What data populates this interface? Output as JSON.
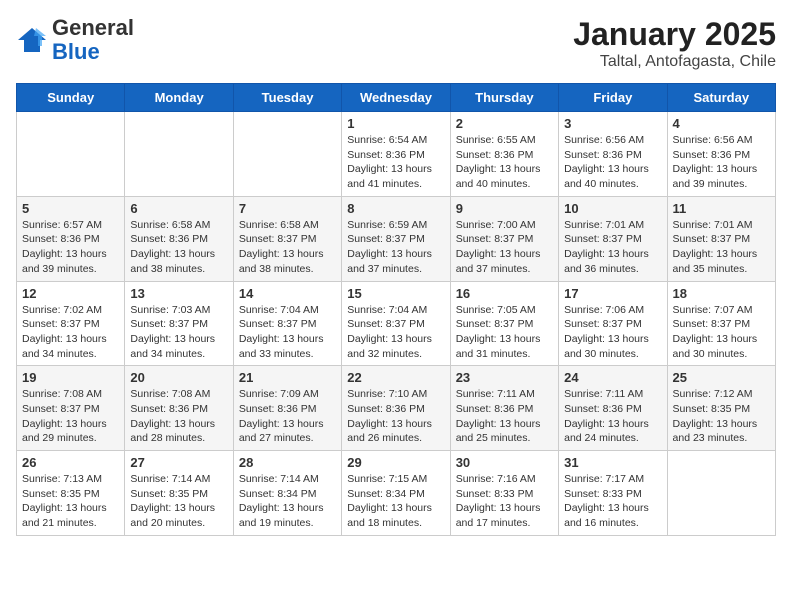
{
  "header": {
    "logo_general": "General",
    "logo_blue": "Blue",
    "title": "January 2025",
    "subtitle": "Taltal, Antofagasta, Chile"
  },
  "weekdays": [
    "Sunday",
    "Monday",
    "Tuesday",
    "Wednesday",
    "Thursday",
    "Friday",
    "Saturday"
  ],
  "weeks": [
    [
      {
        "day": "",
        "info": ""
      },
      {
        "day": "",
        "info": ""
      },
      {
        "day": "",
        "info": ""
      },
      {
        "day": "1",
        "info": "Sunrise: 6:54 AM\nSunset: 8:36 PM\nDaylight: 13 hours\nand 41 minutes."
      },
      {
        "day": "2",
        "info": "Sunrise: 6:55 AM\nSunset: 8:36 PM\nDaylight: 13 hours\nand 40 minutes."
      },
      {
        "day": "3",
        "info": "Sunrise: 6:56 AM\nSunset: 8:36 PM\nDaylight: 13 hours\nand 40 minutes."
      },
      {
        "day": "4",
        "info": "Sunrise: 6:56 AM\nSunset: 8:36 PM\nDaylight: 13 hours\nand 39 minutes."
      }
    ],
    [
      {
        "day": "5",
        "info": "Sunrise: 6:57 AM\nSunset: 8:36 PM\nDaylight: 13 hours\nand 39 minutes."
      },
      {
        "day": "6",
        "info": "Sunrise: 6:58 AM\nSunset: 8:36 PM\nDaylight: 13 hours\nand 38 minutes."
      },
      {
        "day": "7",
        "info": "Sunrise: 6:58 AM\nSunset: 8:37 PM\nDaylight: 13 hours\nand 38 minutes."
      },
      {
        "day": "8",
        "info": "Sunrise: 6:59 AM\nSunset: 8:37 PM\nDaylight: 13 hours\nand 37 minutes."
      },
      {
        "day": "9",
        "info": "Sunrise: 7:00 AM\nSunset: 8:37 PM\nDaylight: 13 hours\nand 37 minutes."
      },
      {
        "day": "10",
        "info": "Sunrise: 7:01 AM\nSunset: 8:37 PM\nDaylight: 13 hours\nand 36 minutes."
      },
      {
        "day": "11",
        "info": "Sunrise: 7:01 AM\nSunset: 8:37 PM\nDaylight: 13 hours\nand 35 minutes."
      }
    ],
    [
      {
        "day": "12",
        "info": "Sunrise: 7:02 AM\nSunset: 8:37 PM\nDaylight: 13 hours\nand 34 minutes."
      },
      {
        "day": "13",
        "info": "Sunrise: 7:03 AM\nSunset: 8:37 PM\nDaylight: 13 hours\nand 34 minutes."
      },
      {
        "day": "14",
        "info": "Sunrise: 7:04 AM\nSunset: 8:37 PM\nDaylight: 13 hours\nand 33 minutes."
      },
      {
        "day": "15",
        "info": "Sunrise: 7:04 AM\nSunset: 8:37 PM\nDaylight: 13 hours\nand 32 minutes."
      },
      {
        "day": "16",
        "info": "Sunrise: 7:05 AM\nSunset: 8:37 PM\nDaylight: 13 hours\nand 31 minutes."
      },
      {
        "day": "17",
        "info": "Sunrise: 7:06 AM\nSunset: 8:37 PM\nDaylight: 13 hours\nand 30 minutes."
      },
      {
        "day": "18",
        "info": "Sunrise: 7:07 AM\nSunset: 8:37 PM\nDaylight: 13 hours\nand 30 minutes."
      }
    ],
    [
      {
        "day": "19",
        "info": "Sunrise: 7:08 AM\nSunset: 8:37 PM\nDaylight: 13 hours\nand 29 minutes."
      },
      {
        "day": "20",
        "info": "Sunrise: 7:08 AM\nSunset: 8:36 PM\nDaylight: 13 hours\nand 28 minutes."
      },
      {
        "day": "21",
        "info": "Sunrise: 7:09 AM\nSunset: 8:36 PM\nDaylight: 13 hours\nand 27 minutes."
      },
      {
        "day": "22",
        "info": "Sunrise: 7:10 AM\nSunset: 8:36 PM\nDaylight: 13 hours\nand 26 minutes."
      },
      {
        "day": "23",
        "info": "Sunrise: 7:11 AM\nSunset: 8:36 PM\nDaylight: 13 hours\nand 25 minutes."
      },
      {
        "day": "24",
        "info": "Sunrise: 7:11 AM\nSunset: 8:36 PM\nDaylight: 13 hours\nand 24 minutes."
      },
      {
        "day": "25",
        "info": "Sunrise: 7:12 AM\nSunset: 8:35 PM\nDaylight: 13 hours\nand 23 minutes."
      }
    ],
    [
      {
        "day": "26",
        "info": "Sunrise: 7:13 AM\nSunset: 8:35 PM\nDaylight: 13 hours\nand 21 minutes."
      },
      {
        "day": "27",
        "info": "Sunrise: 7:14 AM\nSunset: 8:35 PM\nDaylight: 13 hours\nand 20 minutes."
      },
      {
        "day": "28",
        "info": "Sunrise: 7:14 AM\nSunset: 8:34 PM\nDaylight: 13 hours\nand 19 minutes."
      },
      {
        "day": "29",
        "info": "Sunrise: 7:15 AM\nSunset: 8:34 PM\nDaylight: 13 hours\nand 18 minutes."
      },
      {
        "day": "30",
        "info": "Sunrise: 7:16 AM\nSunset: 8:33 PM\nDaylight: 13 hours\nand 17 minutes."
      },
      {
        "day": "31",
        "info": "Sunrise: 7:17 AM\nSunset: 8:33 PM\nDaylight: 13 hours\nand 16 minutes."
      },
      {
        "day": "",
        "info": ""
      }
    ]
  ]
}
